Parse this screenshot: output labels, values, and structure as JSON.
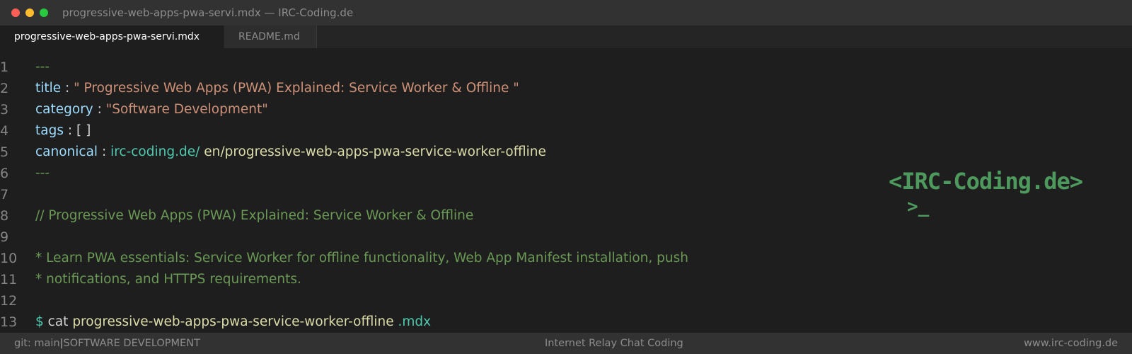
{
  "window": {
    "title": "progressive-web-apps-pwa-servi.mdx — IRC-Coding.de",
    "traffic_lights": {
      "close_color": "#ff5f57",
      "minimize_color": "#febc2e",
      "zoom_color": "#28c840"
    }
  },
  "tabs": [
    {
      "label": "progressive-web-apps-pwa-servi.mdx",
      "active": true
    },
    {
      "label": "README.md",
      "active": false
    }
  ],
  "editor": {
    "lines": [
      {
        "n": "1",
        "dashes": "---"
      },
      {
        "n": "2",
        "key": "title",
        "sep": " : ",
        "value": "\" Progressive Web Apps (PWA) Explained: Service Worker & Offline \""
      },
      {
        "n": "3",
        "key": "category",
        "sep": " : ",
        "value": "\"Software Development\""
      },
      {
        "n": "4",
        "key": "tags",
        "sep": " : ",
        "value": "[ ]"
      },
      {
        "n": "5",
        "key": "canonical",
        "sep": " : ",
        "domain": "irc-coding.de/",
        "path": " en/progressive-web-apps-pwa-service-worker-offline"
      },
      {
        "n": "6",
        "dashes": "---"
      },
      {
        "n": "7"
      },
      {
        "n": "8",
        "comment": "// Progressive Web Apps (PWA) Explained: Service Worker & Offline"
      },
      {
        "n": "9"
      },
      {
        "n": "10",
        "comment": "* Learn PWA essentials: Service Worker for offline functionality, Web App Manifest installation, push"
      },
      {
        "n": "11",
        "comment": "* notifications, and HTTPS requirements."
      },
      {
        "n": "12"
      },
      {
        "n": "13",
        "prompt": "$",
        "command": " cat",
        "filename": " progressive-web-apps-pwa-service-worker-offline",
        "extension": " .mdx"
      }
    ]
  },
  "logo": {
    "text": "<IRC-Coding.de>",
    "cursor": ">_",
    "color": "#4e9a5e"
  },
  "statusbar": {
    "branch": "git: main",
    "separator": "|",
    "category": "SOFTWARE DEVELOPMENT",
    "center": "Internet Relay Chat Coding",
    "right": "www.irc-coding.de"
  }
}
